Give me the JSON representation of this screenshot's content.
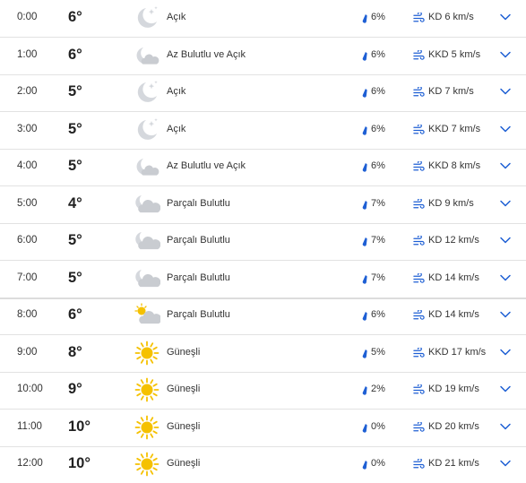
{
  "hours": [
    {
      "time": "0:00",
      "temp": "6°",
      "icon": "moon-stars-icon",
      "condition": "Açık",
      "precip": "6%",
      "wind": "KD 6 km/s"
    },
    {
      "time": "1:00",
      "temp": "6°",
      "icon": "moon-cloud-icon",
      "condition": "Az Bulutlu ve Açık",
      "precip": "6%",
      "wind": "KKD 5 km/s"
    },
    {
      "time": "2:00",
      "temp": "5°",
      "icon": "moon-stars-icon",
      "condition": "Açık",
      "precip": "6%",
      "wind": "KD 7 km/s"
    },
    {
      "time": "3:00",
      "temp": "5°",
      "icon": "moon-stars-icon",
      "condition": "Açık",
      "precip": "6%",
      "wind": "KKD 7 km/s"
    },
    {
      "time": "4:00",
      "temp": "5°",
      "icon": "moon-cloud-icon",
      "condition": "Az Bulutlu ve Açık",
      "precip": "6%",
      "wind": "KKD 8 km/s"
    },
    {
      "time": "5:00",
      "temp": "4°",
      "icon": "moon-partly-cloudy-icon",
      "condition": "Parçalı Bulutlu",
      "precip": "7%",
      "wind": "KD 9 km/s"
    },
    {
      "time": "6:00",
      "temp": "5°",
      "icon": "moon-partly-cloudy-icon",
      "condition": "Parçalı Bulutlu",
      "precip": "7%",
      "wind": "KD 12 km/s"
    },
    {
      "time": "7:00",
      "temp": "5°",
      "icon": "moon-partly-cloudy-icon",
      "condition": "Parçalı Bulutlu",
      "precip": "7%",
      "wind": "KD 14 km/s"
    },
    {
      "time": "8:00",
      "temp": "6°",
      "icon": "sun-cloud-icon",
      "condition": "Parçalı Bulutlu",
      "precip": "6%",
      "wind": "KD 14 km/s"
    },
    {
      "time": "9:00",
      "temp": "8°",
      "icon": "sun-icon",
      "condition": "Güneşli",
      "precip": "5%",
      "wind": "KKD 17 km/s"
    },
    {
      "time": "10:00",
      "temp": "9°",
      "icon": "sun-icon",
      "condition": "Güneşli",
      "precip": "2%",
      "wind": "KD 19 km/s"
    },
    {
      "time": "11:00",
      "temp": "10°",
      "icon": "sun-icon",
      "condition": "Güneşli",
      "precip": "0%",
      "wind": "KD 20 km/s"
    },
    {
      "time": "12:00",
      "temp": "10°",
      "icon": "sun-icon",
      "condition": "Güneşli",
      "precip": "0%",
      "wind": "KD 21 km/s"
    }
  ],
  "colors": {
    "accent": "#1e5fd4",
    "sun": "#f5c100",
    "cloud": "#c9ccd1",
    "moon": "#d5d8dd",
    "separator": "#e2e2e2"
  }
}
